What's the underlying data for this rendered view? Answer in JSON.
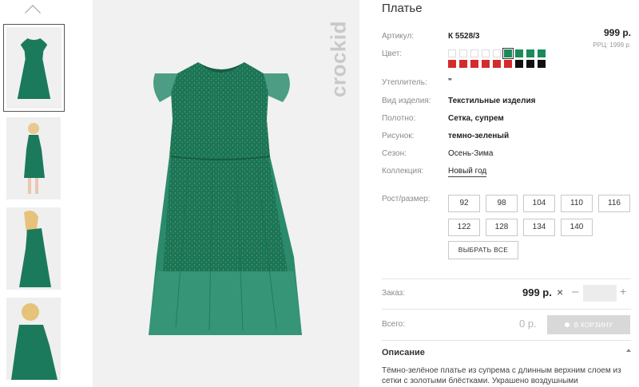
{
  "product": {
    "title": "Платье",
    "price_top": "999 р.",
    "rrc": "РРЦ: 1999 р."
  },
  "details": [
    {
      "label": "Артикул:",
      "value": "К 5528/3"
    },
    {
      "label": "Цвет:",
      "value": ""
    },
    {
      "label": "Утеплитель:",
      "value": "\""
    },
    {
      "label": "Вид изделия:",
      "value": "Текстильные изделия"
    },
    {
      "label": "Полотно:",
      "value": "Сетка, супрем"
    },
    {
      "label": "Рисунок:",
      "value": "темно-зеленый"
    },
    {
      "label": "Сезон:",
      "value": "Осень-Зима"
    },
    {
      "label": "Коллекция:",
      "value": "Новый год"
    }
  ],
  "brand": "crockid",
  "colors": {
    "accent_green": "#1a8a5a",
    "swatch_red": "#d42c2c",
    "swatch_black": "#111111",
    "dress_green": "#1c7a5c"
  },
  "swatch_rows": [
    [
      "white",
      "white",
      "white",
      "white",
      "white",
      "green",
      "green",
      "green",
      "green"
    ],
    [
      "red",
      "red",
      "red",
      "red",
      "red",
      "red",
      "black",
      "black",
      "black"
    ]
  ],
  "selected_swatch": "0-5",
  "sizes": {
    "label": "Рост/размер:",
    "options": [
      "92",
      "98",
      "104",
      "110",
      "116",
      "122",
      "128",
      "134",
      "140"
    ],
    "select_all": "ВЫБРАТЬ ВСЕ"
  },
  "order": {
    "label": "Заказ:",
    "price": "999 р.",
    "times": "×",
    "minus": "–",
    "plus": "+",
    "quantity": ""
  },
  "total": {
    "label": "Всего:",
    "price": "0 р.",
    "cart_button": "В КОРЗИНУ"
  },
  "description": {
    "title": "Описание",
    "text": "Тёмно-зелёное платье из супрема с длинным верхним слоем из сетки с золотыми блёстками. Украшено воздушными крылышками."
  },
  "icons": {
    "thumbs_up_arrow": "chevron-up-icon",
    "collapse": "caret-up-icon",
    "cart": "cart-dot-icon"
  }
}
